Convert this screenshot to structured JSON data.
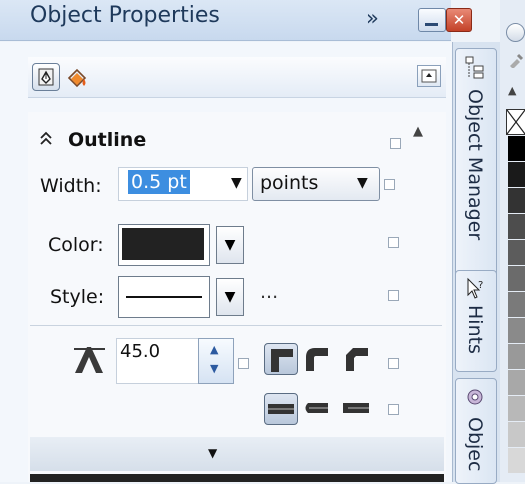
{
  "window": {
    "title": "Object Properties",
    "more_glyph": "»",
    "close_glyph": "✕"
  },
  "toolbar": {
    "tabs": [
      "outline-tab",
      "fill-tab"
    ]
  },
  "outline": {
    "title": "Outline",
    "collapse_glyph": "⌃",
    "width_label": "Width:",
    "width_value": "0.5 pt",
    "units_value": "points",
    "color_label": "Color:",
    "color_value": "#222222",
    "style_label": "Style:",
    "style_more": "...",
    "miter_value": "45.0"
  },
  "dropdown_glyph": "▼",
  "bottom_arrow": "▼",
  "docker_tabs": [
    {
      "label": "Object Manager"
    },
    {
      "label": "Hints"
    },
    {
      "label": "Objec"
    }
  ],
  "palette": {
    "colors": [
      "#000000",
      "#1a1a1a",
      "#333333",
      "#4d4d4d",
      "#5c5c5c",
      "#6b6b6b",
      "#7a7a7a",
      "#8a8a8a",
      "#999999",
      "#a8a8a8",
      "#b8b8b8",
      "#c8c8c8",
      "#d8d8d8"
    ]
  }
}
